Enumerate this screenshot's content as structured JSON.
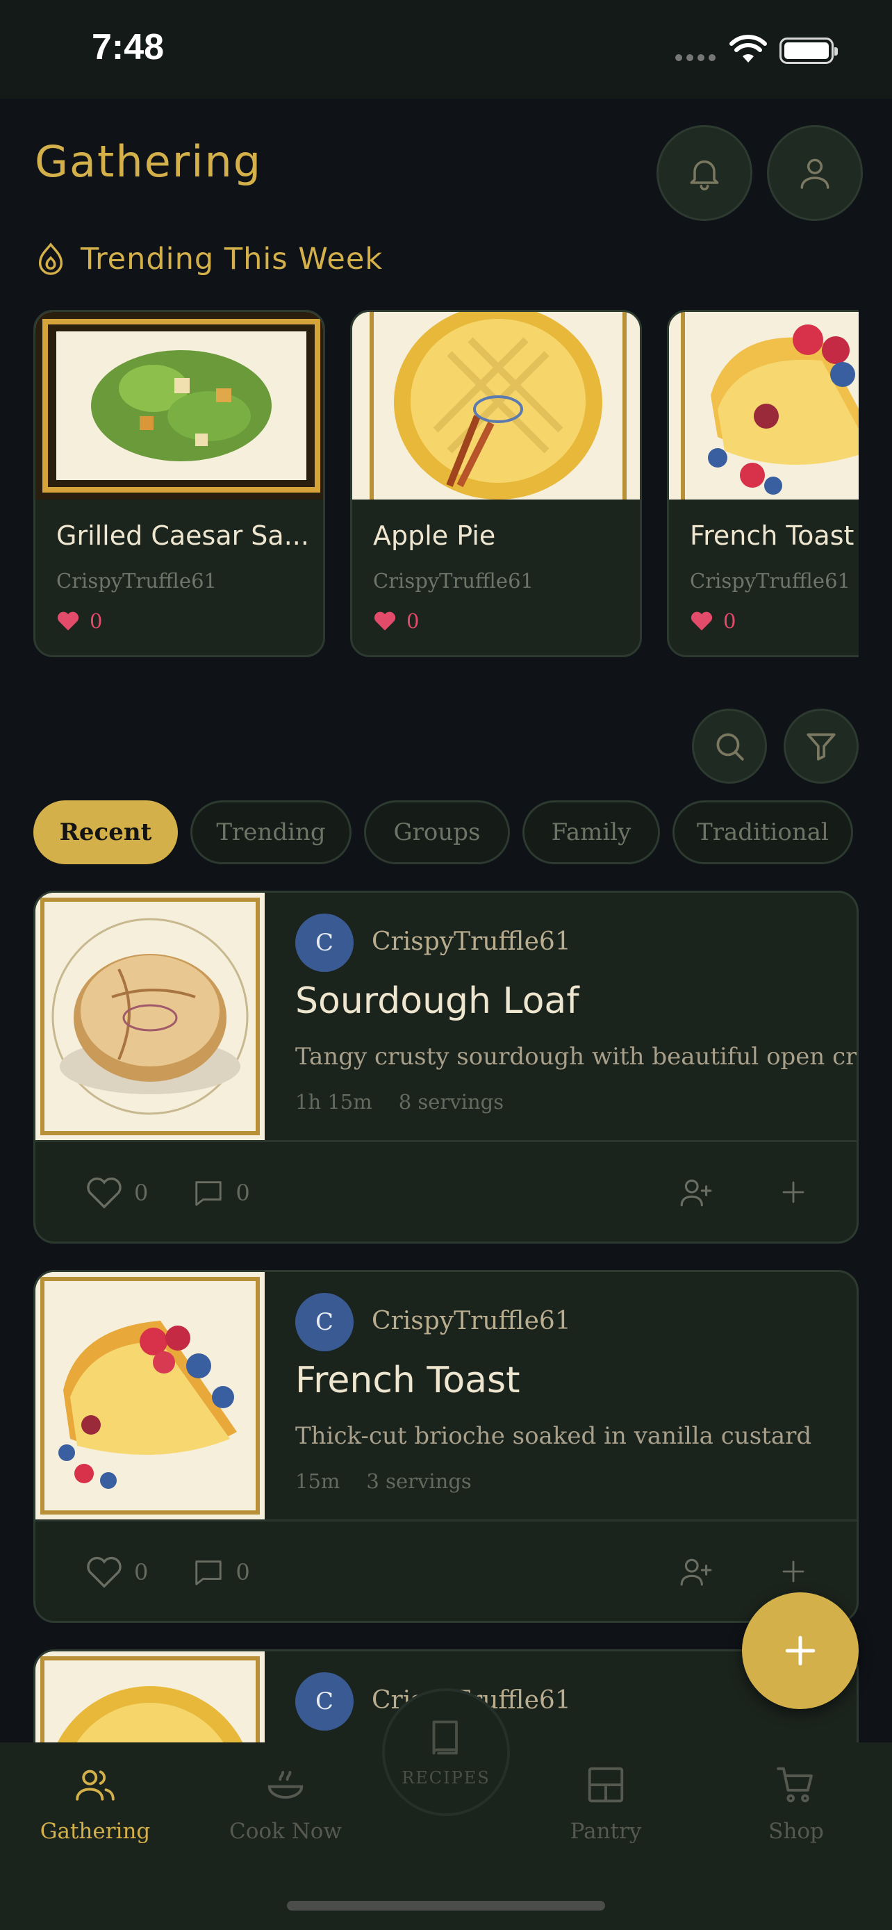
{
  "status_bar": {
    "time": "7:48"
  },
  "header": {
    "title": "Gathering"
  },
  "trending": {
    "title": "Trending This Week",
    "cards": [
      {
        "name": "Grilled Caesar Sa...",
        "author": "CrispyTruffle61",
        "likes": "0"
      },
      {
        "name": "Apple Pie",
        "author": "CrispyTruffle61",
        "likes": "0"
      },
      {
        "name": "French Toast",
        "author": "CrispyTruffle61",
        "likes": "0"
      }
    ]
  },
  "filters": [
    "Recent",
    "Trending",
    "Groups",
    "Family",
    "Traditional"
  ],
  "active_filter": "Recent",
  "recipes": [
    {
      "avatar_letter": "C",
      "author": "CrispyTruffle61",
      "title": "Sourdough Loaf",
      "description": "Tangy crusty sourdough with beautiful open crumb",
      "time": "1h 15m",
      "servings": "8 servings",
      "likes": "0",
      "comments": "0"
    },
    {
      "avatar_letter": "C",
      "author": "CrispyTruffle61",
      "title": "French Toast",
      "description": "Thick-cut brioche soaked in vanilla custard",
      "time": "15m",
      "servings": "3 servings",
      "likes": "0",
      "comments": "0"
    },
    {
      "avatar_letter": "C",
      "author": "CrispyTruffle61"
    }
  ],
  "tabbar": {
    "items": [
      {
        "label": "Gathering",
        "icon": "people-icon",
        "active": true
      },
      {
        "label": "Cook Now",
        "icon": "steaming-bowl-icon",
        "active": false
      },
      {
        "label": "RECIPES",
        "icon": "book-icon",
        "active": false
      },
      {
        "label": "Pantry",
        "icon": "pantry-icon",
        "active": false
      },
      {
        "label": "Shop",
        "icon": "cart-icon",
        "active": false
      }
    ]
  },
  "colors": {
    "accent": "#d4b04a",
    "background": "#0f1217",
    "card": "#1b231d",
    "heart": "#e24b6a",
    "avatar": "#3a5a94"
  }
}
